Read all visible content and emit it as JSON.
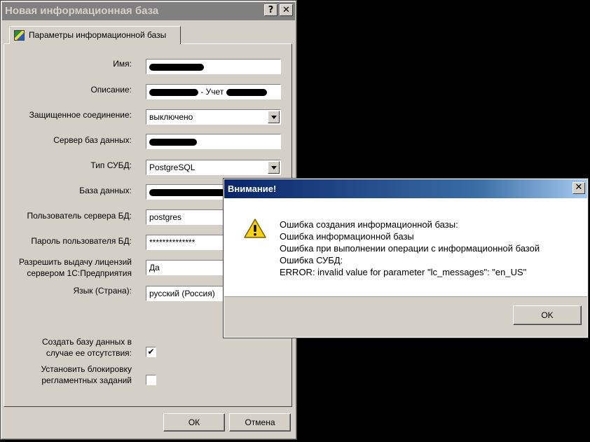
{
  "main_window": {
    "title": "Новая информационная база",
    "help_button": "?",
    "close_button": "✕",
    "tab_label": "Параметры информационной базы",
    "fields": {
      "name_label": "Имя:",
      "description_label": "Описание:",
      "description_visible_text": "- Учет",
      "secure_connection_label": "Защищенное соединение:",
      "secure_connection_value": "выключено",
      "db_server_label": "Сервер баз данных:",
      "dbms_type_label": "Тип СУБД:",
      "dbms_type_value": "PostgreSQL",
      "database_label": "База данных:",
      "db_user_label": "Пользователь сервера БД:",
      "db_user_value": "postgres",
      "db_password_label": "Пароль пользователя БД:",
      "db_password_value": "**************",
      "license_label_line1": "Разрешить выдачу лицензий",
      "license_label_line2": "сервером 1С:Предприятия",
      "license_value": "Да",
      "language_label": "Язык (Страна):",
      "language_value": "русский (Россия)"
    },
    "checkboxes": {
      "create_db_line1": "Создать базу данных в",
      "create_db_line2": "случае ее отсутствия:",
      "create_db_checked": true,
      "block_jobs_line1": "Установить блокировку",
      "block_jobs_line2": "регламентных заданий",
      "block_jobs_checked": false
    },
    "ok_button": "ОК",
    "cancel_button": "Отмена"
  },
  "dialog": {
    "title": "Внимание!",
    "close_button": "✕",
    "icon": "warning-icon",
    "message_lines": [
      "Ошибка создания информационной базы:",
      "Ошибка информационной базы",
      "Ошибка при выполнении операции с информационной базой",
      "Ошибка СУБД:",
      "ERROR:  invalid value for parameter \"lc_messages\": \"en_US\""
    ],
    "ok_button": "OK"
  }
}
